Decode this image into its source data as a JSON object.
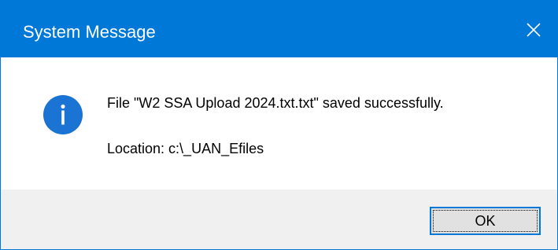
{
  "window": {
    "title": "System Message",
    "accent_color": "#0078d7",
    "close_icon": "close-icon"
  },
  "message": {
    "icon": "info-icon",
    "line1": "File \"W2 SSA Upload 2024.txt.txt\" saved successfully.",
    "line2": "Location: c:\\_UAN_Efiles"
  },
  "buttons": {
    "ok_label": "OK"
  }
}
